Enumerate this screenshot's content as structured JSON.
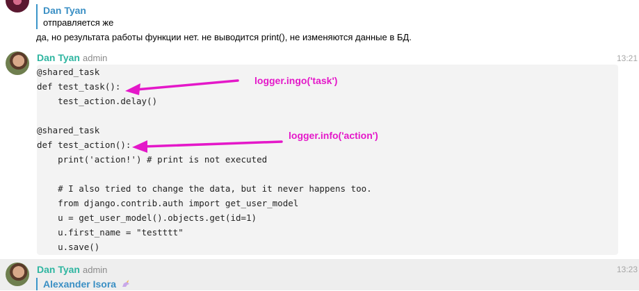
{
  "messages": [
    {
      "reply": {
        "author": "Dan Tyan",
        "text": "отправляется же"
      },
      "text": "да, но результата работы функции нет. не выводится print(), не изменяются данные в БД."
    },
    {
      "author": "Dan Tyan",
      "role": "admin",
      "time": "13:21",
      "code": [
        "@shared_task",
        "def test_task():",
        "    test_action.delay()",
        "",
        "@shared_task",
        "def test_action():",
        "    print('action!') # print is not executed",
        "",
        "    # I also tried to change the data, but it never happens too.",
        "    from django.contrib.auth import get_user_model",
        "    u = get_user_model().objects.get(id=1)",
        "    u.first_name = \"testttt\"",
        "    u.save()"
      ],
      "annotations": [
        "logger.ingo('task')",
        "logger.info('action')"
      ]
    },
    {
      "author": "Dan Tyan",
      "role": "admin",
      "time": "13:23",
      "reply": {
        "author": "Alexander Isora",
        "icon": "unicorn-icon"
      }
    }
  ],
  "colors": {
    "author": "#2eb5a0",
    "reply_author": "#3a8fc4",
    "reply_bar": "#3a95c9",
    "annotation": "#e418c9",
    "code_bg": "#f3f3f3"
  }
}
